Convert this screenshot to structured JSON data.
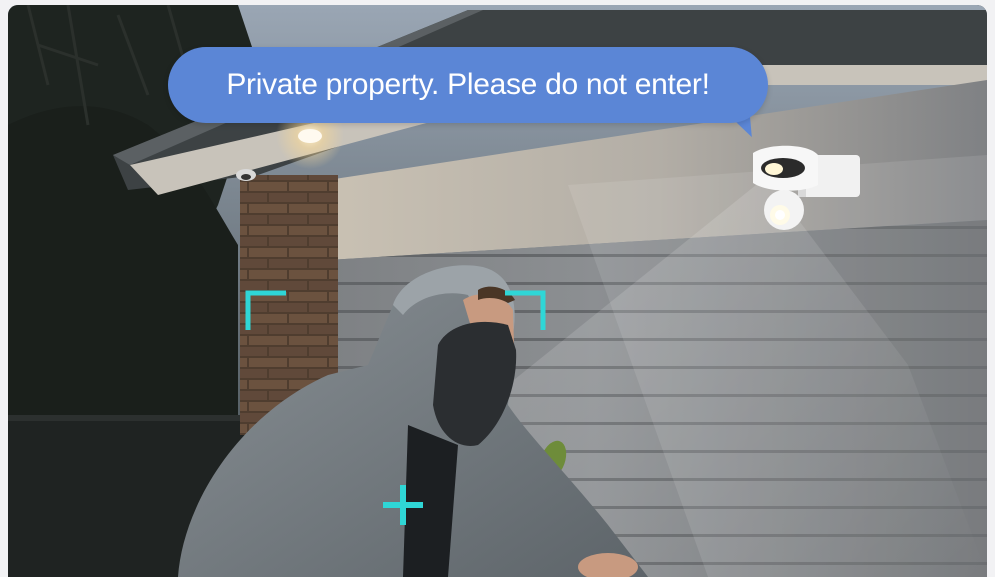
{
  "speech_bubble": {
    "text": "Private property. Please do not enter!"
  },
  "colors": {
    "bubble": "#5b86d6",
    "bubble_text": "#ffffff",
    "detection_brackets": "#2fd6d6"
  },
  "icons": {
    "face_brackets": "face-detection-bracket-icon",
    "body_target": "crosshair-plus-icon"
  }
}
